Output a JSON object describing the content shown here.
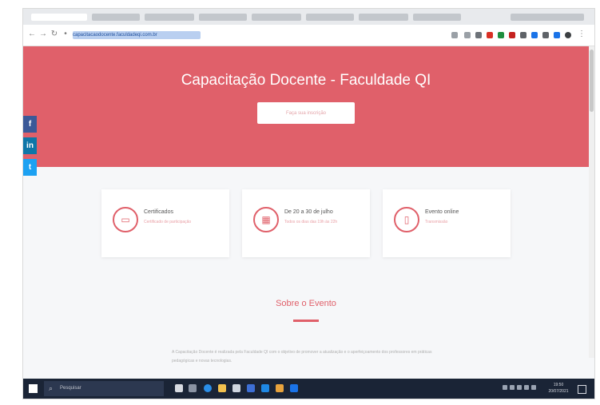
{
  "browser": {
    "url": "capacitacaodocente.faculdadeqi.com.br",
    "nav_icons": [
      "back-arrow-icon",
      "forward-arrow-icon",
      "reload-icon"
    ],
    "tabs_count": 9
  },
  "hero": {
    "title": "Capacitação Docente - Faculdade QI",
    "button_label": "Faça sua inscrição",
    "background": "#e0606a"
  },
  "social": {
    "facebook": "f",
    "linkedin": "in",
    "twitter": "t"
  },
  "cards": [
    {
      "icon": "certificate-icon",
      "title": "Certificados",
      "sub": "Certificado de participação"
    },
    {
      "icon": "calendar-icon",
      "title": "De 20 a 30 de julho",
      "sub": "Todos os dias das 19h às 22h"
    },
    {
      "icon": "online-event-icon",
      "title": "Evento online",
      "sub": "Transmissão"
    }
  ],
  "about": {
    "title": "Sobre o Evento",
    "text": "A Capacitação Docente é realizada pela Faculdade QI com o objetivo de promover a atualização e o aperfeiçoamento dos professores em práticas pedagógicas e novas tecnologias."
  },
  "taskbar": {
    "search_placeholder": "Pesquisar",
    "time": "19:50",
    "date": "20/07/2021"
  },
  "colors": {
    "accent": "#e0606a",
    "taskbar": "#1a2436"
  }
}
